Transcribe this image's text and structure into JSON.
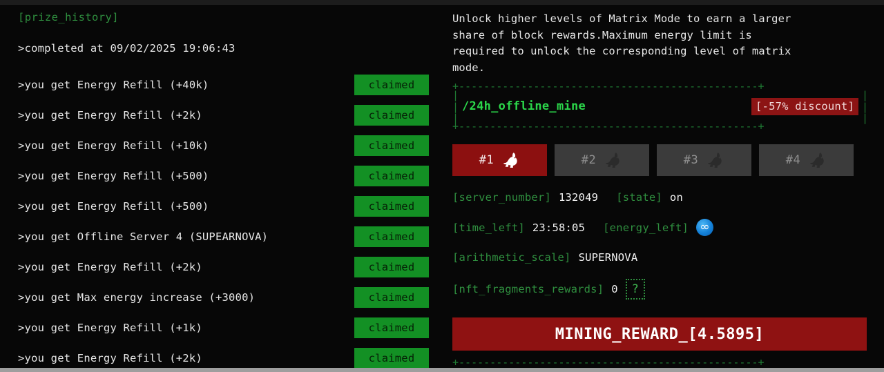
{
  "left_panel": {
    "title": "[prize_history]",
    "completed_line": ">completed at 09/02/2025 19:06:43",
    "claimed_label": "claimed",
    "prizes": [
      {
        "text": ">you get Energy Refill (+40k)",
        "status": "claimed"
      },
      {
        "text": ">you get Energy Refill (+2k)",
        "status": "claimed"
      },
      {
        "text": ">you get Energy Refill (+10k)",
        "status": "claimed"
      },
      {
        "text": ">you get Energy Refill (+500)",
        "status": "claimed"
      },
      {
        "text": ">you get Energy Refill (+500)",
        "status": "claimed"
      },
      {
        "text": ">you get Offline Server 4 (SUPEARNOVA)",
        "status": "claimed"
      },
      {
        "text": ">you get Energy Refill (+2k)",
        "status": "claimed"
      },
      {
        "text": ">you get Max energy increase (+3000)",
        "status": "claimed"
      },
      {
        "text": ">you get Energy Refill (+1k)",
        "status": "claimed"
      },
      {
        "text": ">you get Energy Refill (+2k)",
        "status": "claimed"
      }
    ]
  },
  "right_panel": {
    "description": "Unlock higher levels of Matrix Mode to earn a larger\nshare of block rewards.Maximum energy limit is\nrequired to unlock the corresponding level of matrix\nmode.",
    "header_box": {
      "title": "/24h_offline_mine",
      "discount_badge": "[-57% discount]",
      "rule_top": "+------------------------------------------------+",
      "rule_bottom": "+------------------------------------------------+",
      "side_left": "|\n|\n|",
      "side_right": "|\n|\n|"
    },
    "server_tabs": [
      {
        "label": "#1",
        "icon": "rabbit-icon",
        "active": true
      },
      {
        "label": "#2",
        "icon": "rabbit-icon",
        "active": false
      },
      {
        "label": "#3",
        "icon": "rabbit-icon",
        "active": false
      },
      {
        "label": "#4",
        "icon": "rabbit-icon",
        "active": false
      }
    ],
    "stats": {
      "server_number_key": "[server_number]",
      "server_number_val": "132049",
      "state_key": "[state]",
      "state_val": "on",
      "time_left_key": "[time_left]",
      "time_left_val": "23:58:05",
      "energy_left_key": "[energy_left]",
      "energy_left_val": "∞",
      "arithmetic_scale_key": "[arithmetic_scale]",
      "arithmetic_scale_val": "SUPERNOVA",
      "nft_fragments_key": "[nft_fragments_rewards]",
      "nft_fragments_val": "0",
      "help_label": "?"
    },
    "mining_reward_label": "MINING_REWARD_[4.5895]",
    "footer_rule": "+------------------------------------------------+"
  },
  "colors": {
    "background": "#070707",
    "accent_green": "#2f8f3f",
    "bright_green": "#2bd64a",
    "claimed_green": "#139024",
    "accent_red": "#8f1212",
    "tab_inactive": "#3b3b3b",
    "text": "#e6e6e6"
  }
}
